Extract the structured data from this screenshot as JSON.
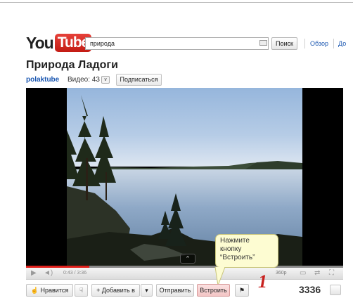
{
  "header": {
    "logo_you": "You",
    "logo_tube": "Tube",
    "search_value": "природа",
    "search_button": "Поиск",
    "nav": [
      "Обзор",
      "До"
    ]
  },
  "video": {
    "title": "Природа Ладоги",
    "channel": "polaktube",
    "video_count_label": "Видео: 43",
    "subscribe_label": "Подписаться"
  },
  "player": {
    "time": "0:43 / 3:36",
    "quality": "360p",
    "progress": 0.2
  },
  "actions": {
    "like": "Нравится",
    "add_to": "Добавить в",
    "share": "Отправить",
    "embed": "Встроить",
    "views": "3336"
  },
  "callout": {
    "lines": [
      "Нажмите",
      "кнопку",
      "“Встроить”"
    ],
    "step": "1"
  },
  "colors": {
    "brand_red": "#d7261d",
    "link_blue": "#1b57b1",
    "callout_bg": "#fdfcd2",
    "step_red": "#c8211f"
  }
}
